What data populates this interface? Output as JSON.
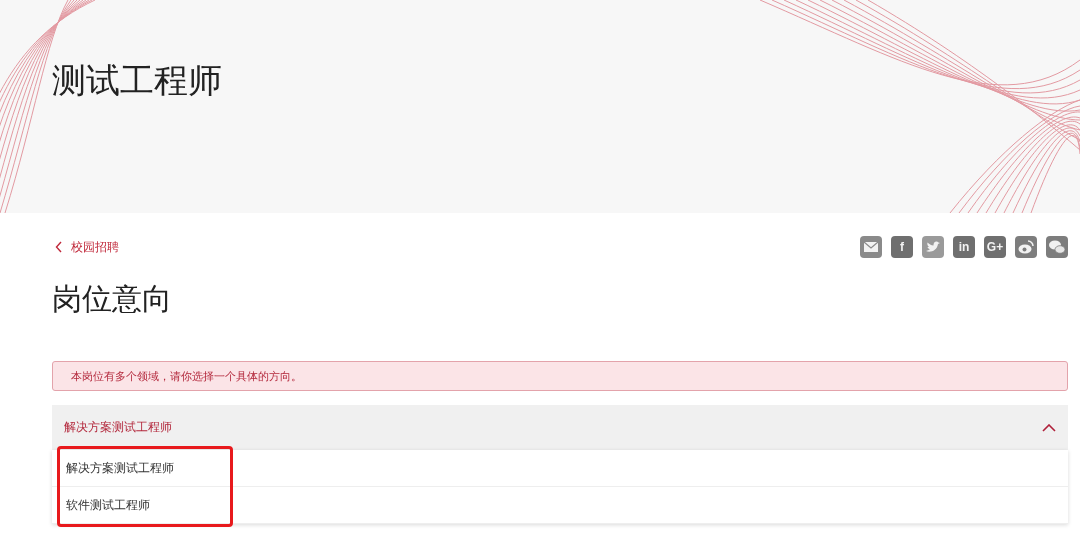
{
  "header": {
    "title": "测试工程师"
  },
  "back_link": {
    "label": "校园招聘"
  },
  "share_icons": [
    {
      "kind": "email"
    },
    {
      "kind": "letter",
      "glyph": "f"
    },
    {
      "kind": "twitter"
    },
    {
      "kind": "letter",
      "glyph": "in"
    },
    {
      "kind": "letter",
      "glyph": "G+"
    },
    {
      "kind": "weibo"
    },
    {
      "kind": "wechat"
    }
  ],
  "section_title": "岗位意向",
  "alert": {
    "text": "本岗位有多个领域，请你选择一个具体的方向。"
  },
  "dropdown": {
    "value": "解决方案测试工程师",
    "expanded": true,
    "options": [
      {
        "label": "解决方案测试工程师"
      },
      {
        "label": "软件测试工程师"
      }
    ]
  }
}
